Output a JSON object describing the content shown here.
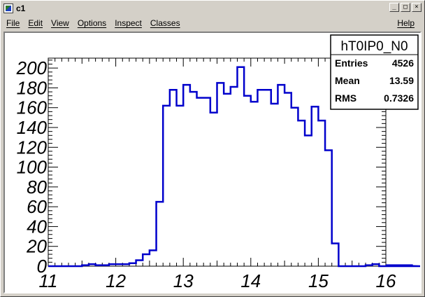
{
  "window": {
    "title": "c1",
    "controls": [
      "_",
      "□",
      "×"
    ]
  },
  "menu": {
    "items": [
      "File",
      "Edit",
      "View",
      "Options",
      "Inspect",
      "Classes"
    ],
    "help": "Help"
  },
  "stats": {
    "title": "hT0IP0_N0",
    "rows": [
      {
        "label": "Entries",
        "value": "4526"
      },
      {
        "label": "Mean",
        "value": "13.59"
      },
      {
        "label": "RMS",
        "value": "0.7326"
      }
    ]
  },
  "colors": {
    "histogram": "#0000cc",
    "frame": "#000000",
    "canvas": "#ffffff",
    "chrome": "#d4d0c8"
  },
  "chart_data": {
    "type": "bar",
    "style": "step",
    "title": "",
    "xlabel": "",
    "ylabel": "",
    "xlim": [
      11,
      16
    ],
    "ylim": [
      0,
      210
    ],
    "bin_width": 0.1,
    "bin_edges_start": 11.0,
    "values": [
      0,
      0,
      0,
      0,
      0,
      1,
      2,
      1,
      1,
      2,
      2,
      2,
      3,
      6,
      12,
      16,
      65,
      162,
      178,
      162,
      183,
      176,
      170,
      170,
      155,
      185,
      174,
      181,
      201,
      172,
      166,
      178,
      178,
      164,
      183,
      175,
      160,
      147,
      132,
      161,
      147,
      117,
      23,
      0,
      0,
      0,
      0,
      1,
      2,
      0,
      0,
      1,
      0,
      1,
      1,
      0,
      0,
      0,
      0,
      0,
      0
    ],
    "x_ticks": [
      11,
      12,
      13,
      14,
      15,
      16
    ],
    "y_ticks": [
      0,
      20,
      40,
      60,
      80,
      100,
      120,
      140,
      160,
      180,
      200
    ],
    "legend": "top-right",
    "grid": false
  }
}
